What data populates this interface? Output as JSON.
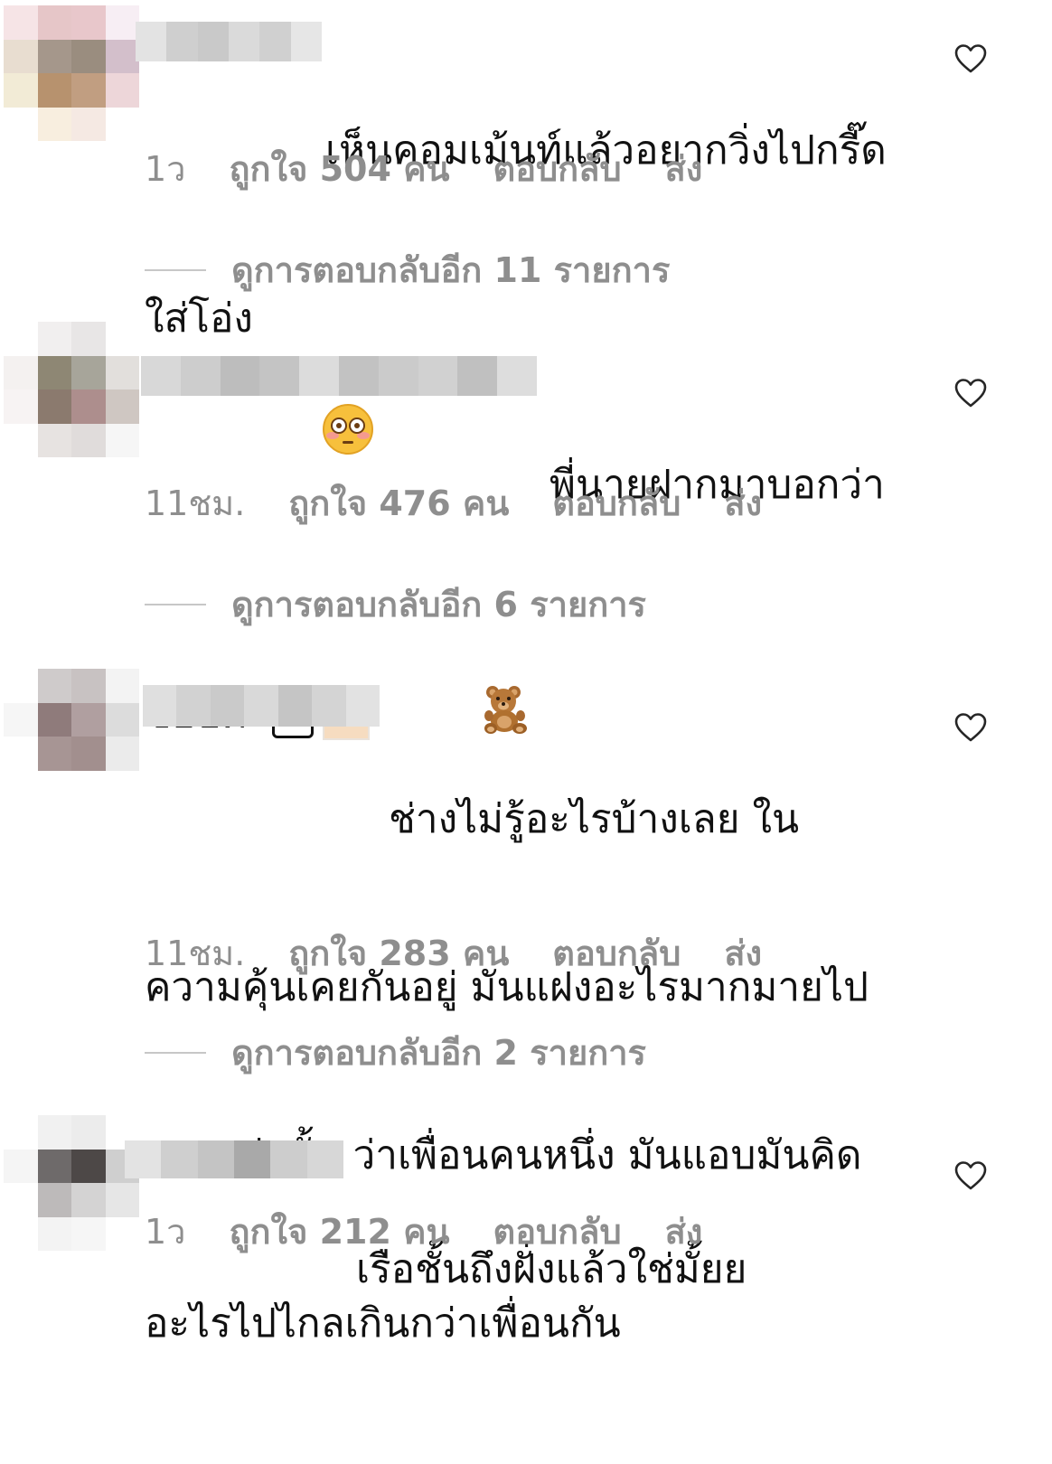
{
  "comments": [
    {
      "text_line1": "เห็นคอมเม้นท์แล้วอยากวิ่งไปกรี๊ด",
      "text_line2": "ใส่โอ่ง",
      "emoji": "flushed-face-emoji",
      "time": "1ว",
      "likes": "ถูกใจ 504 คน",
      "reply": "ตอบกลับ",
      "send": "ส่ง",
      "view_replies": "ดูการตอบกลับอีก 11 รายการ"
    },
    {
      "text_line1": "พี่นายฝากมาบอกว่า",
      "text_line2": "ชอบค่ะ",
      "emoji": "teddy-bear-emoji",
      "time": "11ชม.",
      "likes": "ถูกใจ 476 คน",
      "reply": "ตอบกลับ",
      "send": "ส่ง",
      "view_replies": "ดูการตอบกลับอีก 6 รายการ"
    },
    {
      "text_line1": "ช่างไม่รู้อะไรบ้างเลย ใน",
      "text_line2": "ความคุ้นเคยกันอยู่ มันแฝงอะไรมากมายไป",
      "text_line3": "มากกว่านั้น ว่าเพื่อนคนหนึ่ง มันแอบมันคิด",
      "text_line4": "อะไรไปไกลเกินกว่าเพื่อนกัน",
      "time": "11ชม.",
      "likes": "ถูกใจ 283 คน",
      "reply": "ตอบกลับ",
      "send": "ส่ง",
      "view_replies": "ดูการตอบกลับอีก 2 รายการ"
    },
    {
      "text_line1": "เรือชั้นถึงฝั่งแล้วใช่มั้ยย",
      "time": "1ว",
      "likes": "ถูกใจ 212 คน",
      "reply": "ตอบกลับ",
      "send": "ส่ง"
    }
  ],
  "icons": {
    "like": "heart-outline-icon"
  },
  "colors": {
    "meta_text": "#8e8e8e",
    "divider": "#c7c7c7",
    "text": "#111111"
  }
}
